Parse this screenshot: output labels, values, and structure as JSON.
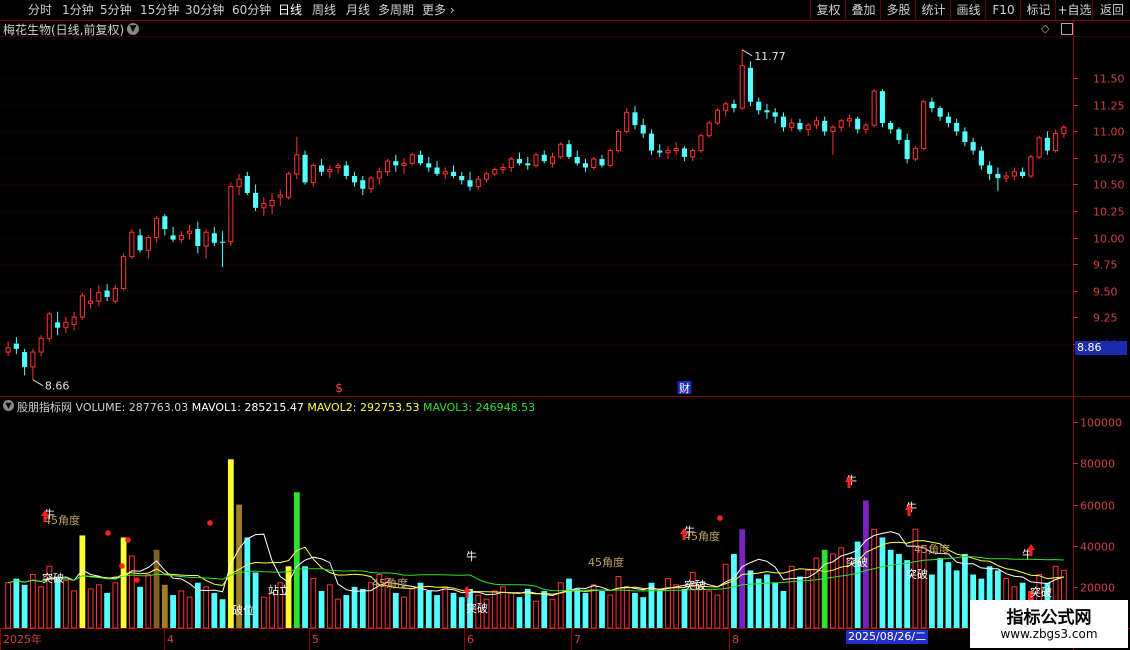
{
  "toolbar": {
    "periods": [
      {
        "label": "分时"
      },
      {
        "label": "1分钟"
      },
      {
        "label": "5分钟"
      },
      {
        "label": "15分钟"
      },
      {
        "label": "30分钟"
      },
      {
        "label": "60分钟"
      },
      {
        "label": "日线"
      },
      {
        "label": "周线"
      },
      {
        "label": "月线"
      },
      {
        "label": "多周期"
      },
      {
        "label": "更多"
      }
    ],
    "active_period": "日线",
    "right_buttons": [
      {
        "label": "复权"
      },
      {
        "label": "叠加"
      },
      {
        "label": "多股"
      },
      {
        "label": "统计"
      },
      {
        "label": "画线"
      },
      {
        "label": "F10"
      },
      {
        "label": "标记"
      },
      {
        "label": "+自选"
      },
      {
        "label": "返回"
      }
    ]
  },
  "stock_title": "梅花生物(日线,前复权)",
  "price_axis": [
    "11.50",
    "11.25",
    "11.00",
    "10.75",
    "10.50",
    "10.25",
    "10.00",
    "9.75",
    "9.50",
    "9.25",
    "9.00"
  ],
  "current_price": "8.86",
  "high_marker": "11.77",
  "low_marker": "8.66",
  "event_markers": {
    "dividend": "$",
    "finance": "财"
  },
  "indicator": {
    "name": "股朋指标网",
    "volume": "VOLUME: 287763.03",
    "mavol1": "MAVOL1: 285215.47",
    "mavol2": "MAVOL2: 292753.53",
    "mavol3": "MAVOL3: 246948.53"
  },
  "volume_axis": [
    "100000",
    "80000",
    "60000",
    "40000",
    "20000"
  ],
  "signal_labels": {
    "niu": "牛",
    "breakout": "突破",
    "angle45": "45角度",
    "break_line": "破位",
    "stand": "站立"
  },
  "dates": {
    "year": "2025年",
    "months": [
      "4",
      "5",
      "6",
      "7",
      "8"
    ],
    "cursor_date": "2025/08/26/二"
  },
  "watermark": {
    "title": "指标公式网",
    "url": "www.zbgs3.com"
  },
  "colors": {
    "up": "#ff3232",
    "down": "#54ffff",
    "grid": "#5a0000",
    "mavol1": "#ffffff",
    "mavol2": "#ffff40",
    "mavol3": "#30e030"
  },
  "chart_data": {
    "type": "candlestick",
    "ylim": [
      8.6,
      11.9
    ],
    "ohlc": [
      [
        8.92,
        9.02,
        8.88,
        8.96
      ],
      [
        9.0,
        9.06,
        8.9,
        8.95
      ],
      [
        8.92,
        8.95,
        8.7,
        8.78
      ],
      [
        8.78,
        8.95,
        8.66,
        8.92
      ],
      [
        8.92,
        9.08,
        8.88,
        9.05
      ],
      [
        9.05,
        9.3,
        9.02,
        9.28
      ],
      [
        9.2,
        9.3,
        9.08,
        9.15
      ],
      [
        9.15,
        9.25,
        9.1,
        9.2
      ],
      [
        9.18,
        9.3,
        9.12,
        9.25
      ],
      [
        9.25,
        9.48,
        9.22,
        9.45
      ],
      [
        9.38,
        9.52,
        9.33,
        9.4
      ],
      [
        9.4,
        9.55,
        9.35,
        9.48
      ],
      [
        9.5,
        9.56,
        9.4,
        9.44
      ],
      [
        9.4,
        9.55,
        9.38,
        9.52
      ],
      [
        9.52,
        9.85,
        9.5,
        9.82
      ],
      [
        9.82,
        10.08,
        9.8,
        10.05
      ],
      [
        10.02,
        10.08,
        9.86,
        9.88
      ],
      [
        9.88,
        10.02,
        9.8,
        10.0
      ],
      [
        10.0,
        10.2,
        9.95,
        10.18
      ],
      [
        10.2,
        10.22,
        10.02,
        10.08
      ],
      [
        10.02,
        10.1,
        9.96,
        9.98
      ],
      [
        9.98,
        10.06,
        9.95,
        10.02
      ],
      [
        10.04,
        10.12,
        9.98,
        10.06
      ],
      [
        10.08,
        10.15,
        9.85,
        9.92
      ],
      [
        9.92,
        10.08,
        9.8,
        10.05
      ],
      [
        10.04,
        10.1,
        9.92,
        9.95
      ],
      [
        9.96,
        10.06,
        9.72,
        9.95
      ],
      [
        9.96,
        10.52,
        9.92,
        10.48
      ],
      [
        10.48,
        10.6,
        10.4,
        10.55
      ],
      [
        10.58,
        10.62,
        10.4,
        10.42
      ],
      [
        10.42,
        10.5,
        10.25,
        10.28
      ],
      [
        10.28,
        10.38,
        10.2,
        10.32
      ],
      [
        10.3,
        10.42,
        10.22,
        10.35
      ],
      [
        10.38,
        10.45,
        10.3,
        10.4
      ],
      [
        10.38,
        10.62,
        10.36,
        10.6
      ],
      [
        10.6,
        10.95,
        10.55,
        10.78
      ],
      [
        10.78,
        10.82,
        10.5,
        10.52
      ],
      [
        10.52,
        10.7,
        10.48,
        10.68
      ],
      [
        10.68,
        10.74,
        10.58,
        10.62
      ],
      [
        10.62,
        10.68,
        10.56,
        10.64
      ],
      [
        10.66,
        10.7,
        10.6,
        10.68
      ],
      [
        10.68,
        10.72,
        10.55,
        10.58
      ],
      [
        10.58,
        10.62,
        10.48,
        10.52
      ],
      [
        10.54,
        10.58,
        10.4,
        10.46
      ],
      [
        10.46,
        10.58,
        10.42,
        10.56
      ],
      [
        10.56,
        10.66,
        10.5,
        10.62
      ],
      [
        10.62,
        10.74,
        10.58,
        10.72
      ],
      [
        10.72,
        10.78,
        10.62,
        10.68
      ],
      [
        10.68,
        10.75,
        10.6,
        10.7
      ],
      [
        10.7,
        10.8,
        10.68,
        10.78
      ],
      [
        10.78,
        10.82,
        10.68,
        10.7
      ],
      [
        10.7,
        10.76,
        10.62,
        10.66
      ],
      [
        10.66,
        10.72,
        10.58,
        10.6
      ],
      [
        10.6,
        10.66,
        10.55,
        10.62
      ],
      [
        10.62,
        10.68,
        10.56,
        10.58
      ],
      [
        10.58,
        10.62,
        10.5,
        10.54
      ],
      [
        10.54,
        10.62,
        10.44,
        10.48
      ],
      [
        10.48,
        10.58,
        10.45,
        10.55
      ],
      [
        10.55,
        10.62,
        10.52,
        10.6
      ],
      [
        10.6,
        10.66,
        10.58,
        10.64
      ],
      [
        10.64,
        10.7,
        10.6,
        10.66
      ],
      [
        10.66,
        10.76,
        10.62,
        10.74
      ],
      [
        10.74,
        10.8,
        10.68,
        10.7
      ],
      [
        10.7,
        10.76,
        10.64,
        10.68
      ],
      [
        10.68,
        10.8,
        10.66,
        10.78
      ],
      [
        10.78,
        10.82,
        10.7,
        10.72
      ],
      [
        10.7,
        10.8,
        10.66,
        10.76
      ],
      [
        10.76,
        10.9,
        10.74,
        10.88
      ],
      [
        10.88,
        10.92,
        10.74,
        10.76
      ],
      [
        10.76,
        10.82,
        10.68,
        10.7
      ],
      [
        10.7,
        10.74,
        10.62,
        10.66
      ],
      [
        10.66,
        10.76,
        10.64,
        10.74
      ],
      [
        10.74,
        10.78,
        10.66,
        10.68
      ],
      [
        10.68,
        10.84,
        10.66,
        10.82
      ],
      [
        10.82,
        11.02,
        10.8,
        11.0
      ],
      [
        11.0,
        11.22,
        10.98,
        11.18
      ],
      [
        11.18,
        11.24,
        11.02,
        11.06
      ],
      [
        11.06,
        11.12,
        10.94,
        10.98
      ],
      [
        10.98,
        11.02,
        10.78,
        10.82
      ],
      [
        10.82,
        10.88,
        10.76,
        10.8
      ],
      [
        10.8,
        10.86,
        10.74,
        10.82
      ],
      [
        10.82,
        10.9,
        10.78,
        10.84
      ],
      [
        10.84,
        10.86,
        10.72,
        10.76
      ],
      [
        10.76,
        10.84,
        10.72,
        10.82
      ],
      [
        10.82,
        10.98,
        10.8,
        10.96
      ],
      [
        10.96,
        11.1,
        10.94,
        11.08
      ],
      [
        11.08,
        11.22,
        11.06,
        11.2
      ],
      [
        11.2,
        11.28,
        11.14,
        11.26
      ],
      [
        11.26,
        11.3,
        11.18,
        11.22
      ],
      [
        11.22,
        11.77,
        11.2,
        11.62
      ],
      [
        11.6,
        11.66,
        11.24,
        11.28
      ],
      [
        11.28,
        11.32,
        11.16,
        11.2
      ],
      [
        11.2,
        11.26,
        11.12,
        11.18
      ],
      [
        11.18,
        11.22,
        11.08,
        11.14
      ],
      [
        11.14,
        11.18,
        11.0,
        11.04
      ],
      [
        11.04,
        11.12,
        11.0,
        11.08
      ],
      [
        11.08,
        11.12,
        11.0,
        11.02
      ],
      [
        11.02,
        11.08,
        10.96,
        11.06
      ],
      [
        11.06,
        11.14,
        11.02,
        11.1
      ],
      [
        11.1,
        11.14,
        10.96,
        11.0
      ],
      [
        11.0,
        11.06,
        10.78,
        11.04
      ],
      [
        11.04,
        11.12,
        11.0,
        11.1
      ],
      [
        11.1,
        11.16,
        11.04,
        11.12
      ],
      [
        11.12,
        11.14,
        10.98,
        11.02
      ],
      [
        11.02,
        11.08,
        10.98,
        11.06
      ],
      [
        11.06,
        11.4,
        11.04,
        11.38
      ],
      [
        11.38,
        11.4,
        11.04,
        11.08
      ],
      [
        11.08,
        11.1,
        10.98,
        11.02
      ],
      [
        11.02,
        11.04,
        10.88,
        10.92
      ],
      [
        10.92,
        10.98,
        10.7,
        10.74
      ],
      [
        10.74,
        10.86,
        10.72,
        10.84
      ],
      [
        10.84,
        11.3,
        10.82,
        11.28
      ],
      [
        11.28,
        11.32,
        11.18,
        11.22
      ],
      [
        11.22,
        11.24,
        11.1,
        11.14
      ],
      [
        11.14,
        11.18,
        11.04,
        11.08
      ],
      [
        11.08,
        11.12,
        10.96,
        11.0
      ],
      [
        11.0,
        11.04,
        10.86,
        10.9
      ],
      [
        10.9,
        10.94,
        10.78,
        10.82
      ],
      [
        10.82,
        10.86,
        10.64,
        10.68
      ],
      [
        10.68,
        10.72,
        10.54,
        10.6
      ],
      [
        10.6,
        10.66,
        10.44,
        10.56
      ],
      [
        10.56,
        10.62,
        10.52,
        10.58
      ],
      [
        10.58,
        10.66,
        10.54,
        10.62
      ],
      [
        10.62,
        10.66,
        10.56,
        10.58
      ],
      [
        10.58,
        10.78,
        10.56,
        10.76
      ],
      [
        10.76,
        10.96,
        10.74,
        10.94
      ],
      [
        10.94,
        11.0,
        10.78,
        10.82
      ],
      [
        10.82,
        11.02,
        10.8,
        10.98
      ],
      [
        10.98,
        11.06,
        10.94,
        11.04
      ]
    ],
    "volume": [
      22000,
      24000,
      21000,
      26000,
      20000,
      30000,
      25000,
      23000,
      18000,
      45000,
      19000,
      21000,
      17000,
      22000,
      44000,
      35000,
      20000,
      26000,
      38000,
      21000,
      16000,
      18000,
      15000,
      22000,
      20000,
      17000,
      14000,
      82000,
      60000,
      44000,
      27000,
      15000,
      17000,
      22000,
      30000,
      66000,
      30000,
      24000,
      18000,
      21000,
      14000,
      16000,
      20000,
      19000,
      22000,
      26000,
      24000,
      17000,
      15000,
      19000,
      22000,
      18000,
      16000,
      20000,
      17000,
      15000,
      19000,
      16000,
      14000,
      18000,
      20000,
      17000,
      15000,
      19000,
      13000,
      18000,
      14000,
      22000,
      24000,
      19000,
      17000,
      21000,
      18000,
      16000,
      25000,
      20000,
      17000,
      15000,
      22000,
      18000,
      24000,
      21000,
      19000,
      27000,
      20000,
      18000,
      16000,
      31000,
      36000,
      48000,
      28000,
      24000,
      26000,
      22000,
      18000,
      30000,
      25000,
      28000,
      34000,
      38000,
      36000,
      39000,
      34000,
      42000,
      62000,
      48000,
      44000,
      38000,
      36000,
      33000,
      48000,
      40000,
      26000,
      34000,
      32000,
      28000,
      36000,
      26000,
      24000,
      30000,
      28000,
      24000,
      20000,
      22000,
      18000,
      26000,
      22000,
      30000,
      28000
    ],
    "volume_ylim": [
      0,
      105000
    ],
    "series": [
      {
        "name": "MAVOL1"
      },
      {
        "name": "MAVOL2"
      },
      {
        "name": "MAVOL3"
      }
    ]
  }
}
